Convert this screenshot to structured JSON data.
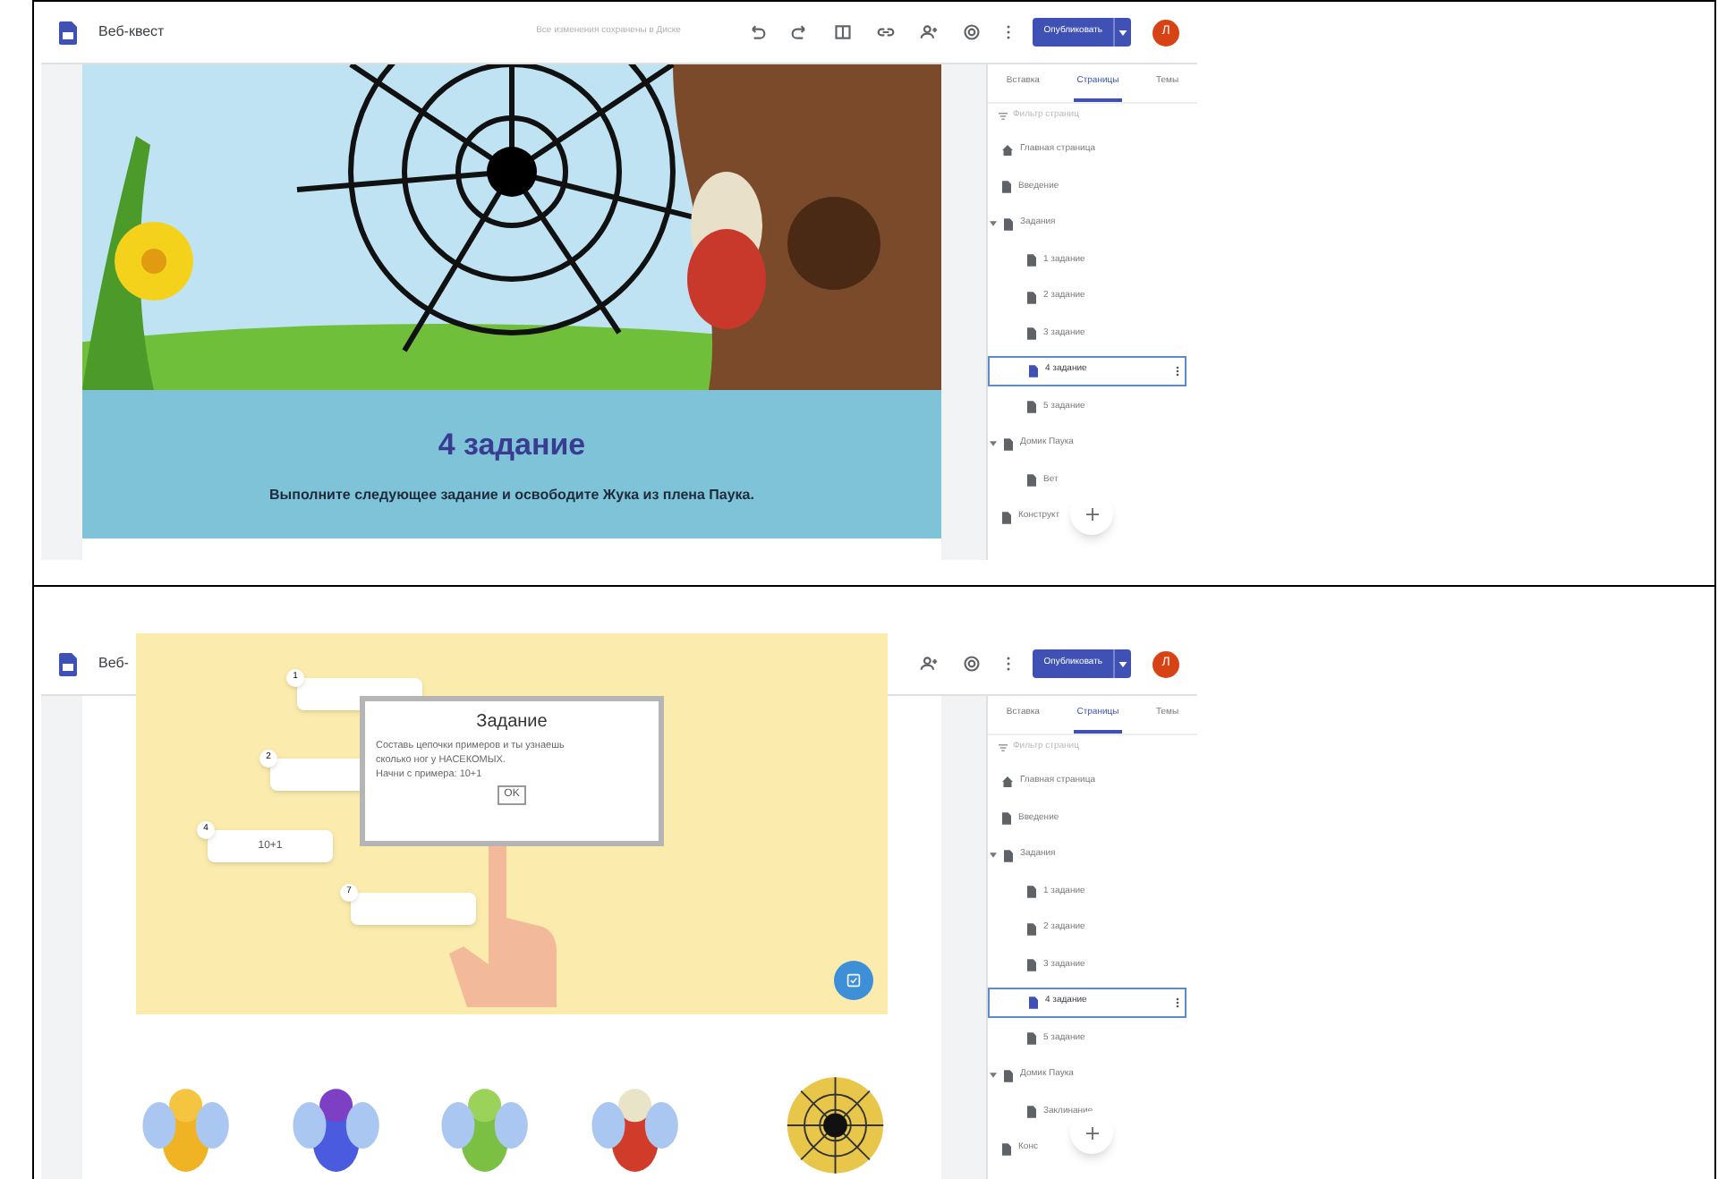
{
  "screens": [
    {
      "topbar": {
        "site_title": "Веб-квест",
        "covered": false,
        "save_status": "Все изменения сохранены в Диске",
        "publish_label": "Опубликовать",
        "avatar": "Л"
      },
      "sidebar": {
        "tabs": [
          {
            "label": "Вставка",
            "selected": false
          },
          {
            "label": "Страницы",
            "selected": true
          },
          {
            "label": "Темы",
            "selected": false
          }
        ],
        "filter_placeholder": "Фильтр страниц",
        "pages": [
          {
            "label": "Главная страница",
            "kind": "home",
            "selected": false
          },
          {
            "label": "Введение",
            "kind": "page",
            "selected": false
          },
          {
            "label": "Задания",
            "kind": "page",
            "selected": false,
            "expanded": true,
            "children": [
              {
                "label": "1 задание",
                "kind": "page",
                "selected": false
              },
              {
                "label": "2 задание",
                "kind": "page",
                "selected": false
              },
              {
                "label": "3 задание",
                "kind": "page",
                "selected": false
              },
              {
                "label": "4 задание",
                "kind": "page",
                "selected": true
              },
              {
                "label": "5 задание",
                "kind": "page",
                "selected": false
              }
            ]
          },
          {
            "label": "Домик Паука",
            "kind": "page",
            "selected": false,
            "expanded": true,
            "children": [
              {
                "label": "Вет",
                "kind": "page",
                "selected": false
              }
            ]
          },
          {
            "label": "Конструкт",
            "kind": "page",
            "selected": false
          }
        ]
      },
      "canvas": {
        "kind": "banner",
        "heading": "4 задание",
        "text": "Выполните следующее задание и освободите Жука из плена Паука."
      }
    },
    {
      "topbar": {
        "site_title": "Веб-",
        "covered": true,
        "publish_label": "Опубликовать",
        "avatar": "Л"
      },
      "sidebar": {
        "tabs": [
          {
            "label": "Вставка",
            "selected": false
          },
          {
            "label": "Страницы",
            "selected": true
          },
          {
            "label": "Темы",
            "selected": false
          }
        ],
        "filter_placeholder": "Фильтр страниц",
        "pages": [
          {
            "label": "Главная страница",
            "kind": "home",
            "selected": false
          },
          {
            "label": "Введение",
            "kind": "page",
            "selected": false
          },
          {
            "label": "Задания",
            "kind": "page",
            "selected": false,
            "expanded": true,
            "children": [
              {
                "label": "1 задание",
                "kind": "page",
                "selected": false
              },
              {
                "label": "2 задание",
                "kind": "page",
                "selected": false
              },
              {
                "label": "3 задание",
                "kind": "page",
                "selected": false
              },
              {
                "label": "4 задание",
                "kind": "page",
                "selected": true
              },
              {
                "label": "5 задание",
                "kind": "page",
                "selected": false
              }
            ]
          },
          {
            "label": "Домик Паука",
            "kind": "page",
            "selected": false,
            "expanded": true,
            "children": [
              {
                "label": "Заклинание",
                "kind": "page",
                "selected": false
              }
            ]
          },
          {
            "label": "Конс",
            "kind": "page",
            "selected": false
          }
        ]
      },
      "canvas": {
        "kind": "game",
        "dialog": {
          "title": "Задание",
          "lines": [
            "Составь цепочки примеров и ты узнаешь",
            "сколько ног у НАСЕКОМЫХ.",
            "Начни с примера: 10+1"
          ],
          "button": "OK"
        },
        "chips": [
          {
            "number": "1"
          },
          {
            "number": "2"
          },
          {
            "number": "4",
            "value": "10+1"
          },
          {
            "number": "7"
          }
        ]
      }
    }
  ]
}
